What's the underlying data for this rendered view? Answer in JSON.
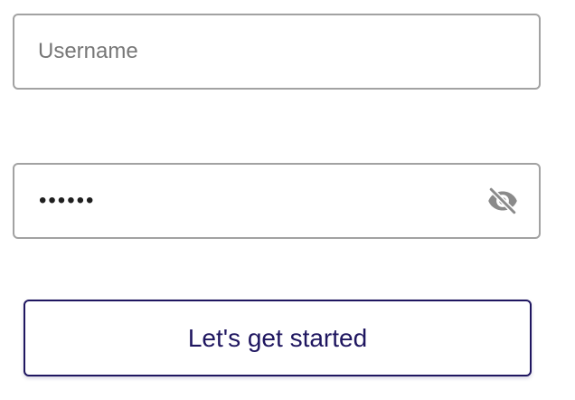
{
  "form": {
    "username": {
      "placeholder": "Username",
      "value": ""
    },
    "password": {
      "masked_value": "••••••",
      "visibility_icon": "eye-slash-icon"
    },
    "submit_label": "Let's get started"
  },
  "colors": {
    "field_border": "#a2a2a2",
    "placeholder": "#777777",
    "icon": "#8a8a8a",
    "accent": "#1f1660"
  }
}
